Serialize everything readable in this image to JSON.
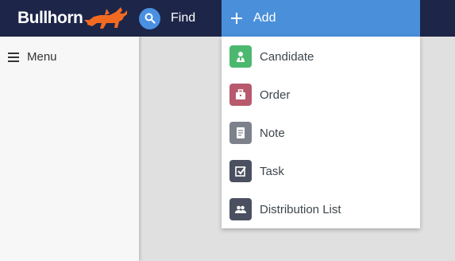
{
  "header": {
    "logo_text": "Bullhorn",
    "find_label": "Find",
    "add_label": "Add",
    "colors": {
      "bar": "#1d2548",
      "add_tab": "#4a8fd9",
      "find_circle": "#4a90e2",
      "logo_accent": "#f26a21"
    }
  },
  "sidebar": {
    "menu_label": "Menu"
  },
  "add_menu": {
    "items": [
      {
        "label": "Candidate",
        "icon": "candidate-icon",
        "color": "#4cb86f"
      },
      {
        "label": "Order",
        "icon": "briefcase-icon",
        "color": "#b85a6e"
      },
      {
        "label": "Note",
        "icon": "note-icon",
        "color": "#7d818c"
      },
      {
        "label": "Task",
        "icon": "task-checkbox-icon",
        "color": "#4b5060"
      },
      {
        "label": "Distribution List",
        "icon": "people-icon",
        "color": "#4b5060"
      }
    ]
  }
}
